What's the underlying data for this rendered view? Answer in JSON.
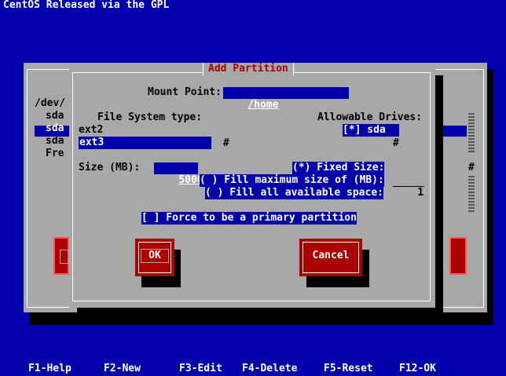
{
  "header": {
    "title": "CentOS Released via the GPL"
  },
  "background_window": {
    "device_header": "/dev/",
    "rows": [
      "sda",
      "sda",
      "sda",
      "Fre"
    ],
    "selected_row_index": 1
  },
  "dialog": {
    "title": "Add Partition",
    "mount_point_label": "Mount Point:",
    "mount_point_value": "/home",
    "fs_type_label": "File System type:",
    "fs_types": [
      "ext2",
      "ext3"
    ],
    "fs_selected_index": 1,
    "scroll_mark": "#",
    "drives_label": "Allowable Drives:",
    "drive_item": "[*] sda",
    "size_label": "Size (MB):",
    "size_value": "5000",
    "fixed_size_label": "(*) Fixed Size:",
    "fill_max_label": "( ) Fill maximum size of (MB):",
    "fill_max_value": "1",
    "fill_all_label": "( ) Fill all available space:",
    "force_primary_label": "[ ] Force to be a primary partition",
    "ok_label": "OK",
    "cancel_label": "Cancel"
  },
  "footer": {
    "keys": [
      "F1-Help",
      "F2-New",
      "F3-Edit",
      "F4-Delete",
      "F5-Reset",
      "F12-OK"
    ]
  },
  "colors": {
    "screen_bg": "#0000aa",
    "window_bg": "#a8a8a8",
    "title_red": "#aa0000",
    "button_red": "#aa0000",
    "text_white": "#ffffff"
  }
}
